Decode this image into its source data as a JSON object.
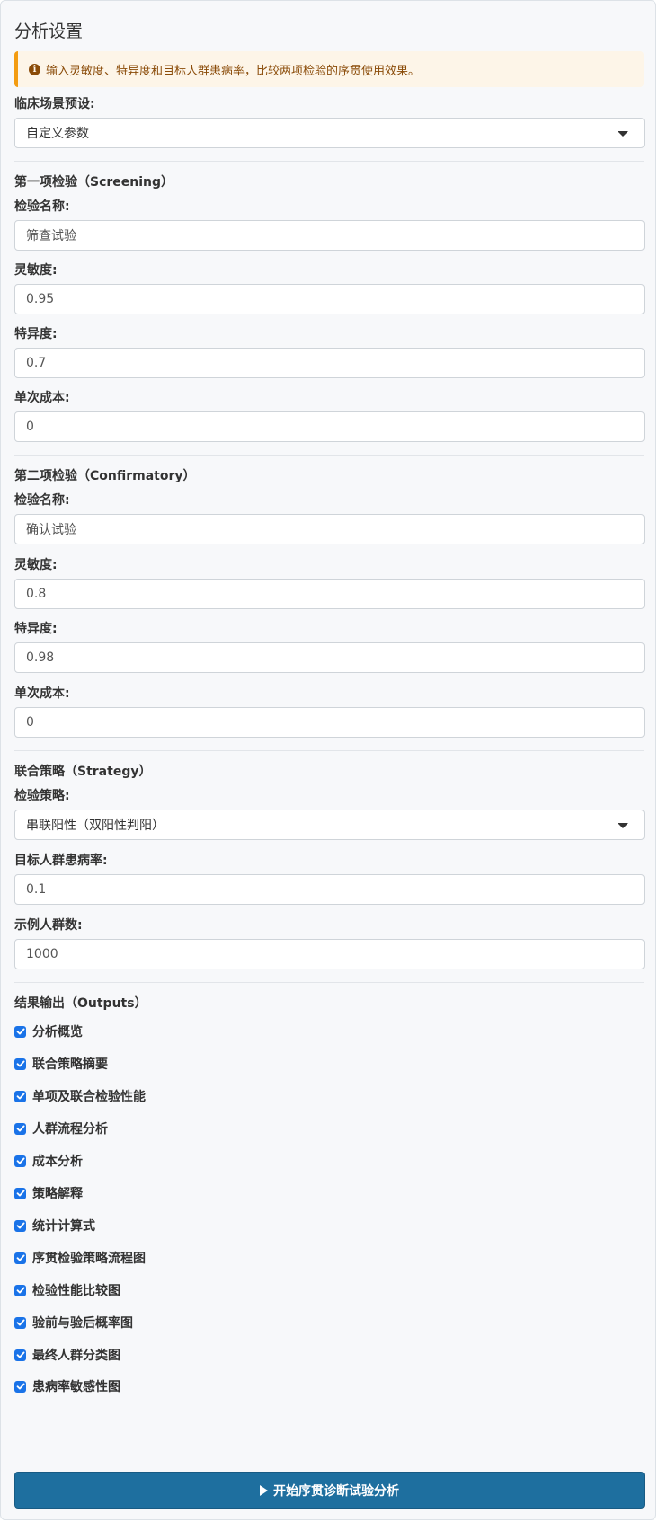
{
  "title": "分析设置",
  "alert": {
    "icon": "info-icon",
    "text": "输入灵敏度、特异度和目标人群患病率，比较两项检验的序贯使用效果。"
  },
  "preset": {
    "label": "临床场景预设:",
    "value": "自定义参数"
  },
  "test1": {
    "heading": "第一项检验（Screening）",
    "name_label": "检验名称:",
    "name_value": "筛查试验",
    "sens_label": "灵敏度:",
    "sens_value": "0.95",
    "spec_label": "特异度:",
    "spec_value": "0.7",
    "cost_label": "单次成本:",
    "cost_value": "0"
  },
  "test2": {
    "heading": "第二项检验（Confirmatory）",
    "name_label": "检验名称:",
    "name_value": "确认试验",
    "sens_label": "灵敏度:",
    "sens_value": "0.8",
    "spec_label": "特异度:",
    "spec_value": "0.98",
    "cost_label": "单次成本:",
    "cost_value": "0"
  },
  "strategy": {
    "heading": "联合策略（Strategy）",
    "strategy_label": "检验策略:",
    "strategy_value": "串联阳性（双阳性判阳）",
    "prev_label": "目标人群患病率:",
    "prev_value": "0.1",
    "pop_label": "示例人群数:",
    "pop_value": "1000"
  },
  "outputs": {
    "heading": "结果输出（Outputs）",
    "items": [
      "分析概览",
      "联合策略摘要",
      "单项及联合检验性能",
      "人群流程分析",
      "成本分析",
      "策略解释",
      "统计计算式",
      "序贯检验策略流程图",
      "检验性能比较图",
      "验前与验后概率图",
      "最终人群分类图",
      "患病率敏感性图"
    ],
    "checked": [
      true,
      true,
      true,
      true,
      true,
      true,
      true,
      true,
      true,
      true,
      true,
      true
    ]
  },
  "run_button": {
    "icon": "play-icon",
    "label": "开始序贯诊断试验分析"
  },
  "colors": {
    "accent": "#1e6f9f",
    "checkbox": "#1a73e8",
    "alert_border": "#f39c12",
    "alert_bg": "#fdf5e8"
  }
}
